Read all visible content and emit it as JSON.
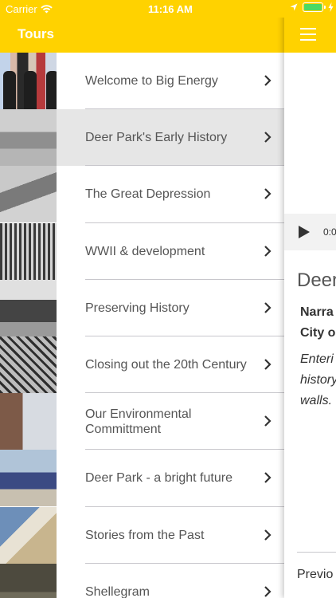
{
  "status_bar": {
    "carrier": "Carrier",
    "time": "11:16 AM",
    "battery_color": "#4cd964"
  },
  "colors": {
    "accent": "#ffd200",
    "menu_text": "#555555",
    "selected_row": "#e6e6e6"
  },
  "menu": {
    "title": "Tours",
    "items": [
      {
        "label": "Welcome to Big Energy",
        "icon": "chevron-right-icon"
      },
      {
        "label": "Deer Park's Early History",
        "icon": "chevron-right-icon",
        "selected": true
      },
      {
        "label": "The Great Depression",
        "icon": "chevron-right-icon"
      },
      {
        "label": "WWII & development",
        "icon": "chevron-right-icon"
      },
      {
        "label": "Preserving History",
        "icon": "chevron-right-icon"
      },
      {
        "label": "Closing out the 20th Century",
        "icon": "chevron-right-icon"
      },
      {
        "label": "Our Environmental Committment",
        "icon": "chevron-right-icon"
      },
      {
        "label": "Deer Park - a bright future",
        "icon": "chevron-right-icon"
      },
      {
        "label": "Stories from the Past",
        "icon": "chevron-right-icon"
      },
      {
        "label": "Shellegram",
        "icon": "chevron-right-icon"
      }
    ]
  },
  "content": {
    "audio_time": "0:0",
    "title_fragment": "Deer",
    "narrator_line1": "Narra",
    "narrator_line2": "City o",
    "excerpt_line1": "Enteri",
    "excerpt_line2": "history",
    "excerpt_line3": "walls.",
    "previous_label": "Previo"
  }
}
